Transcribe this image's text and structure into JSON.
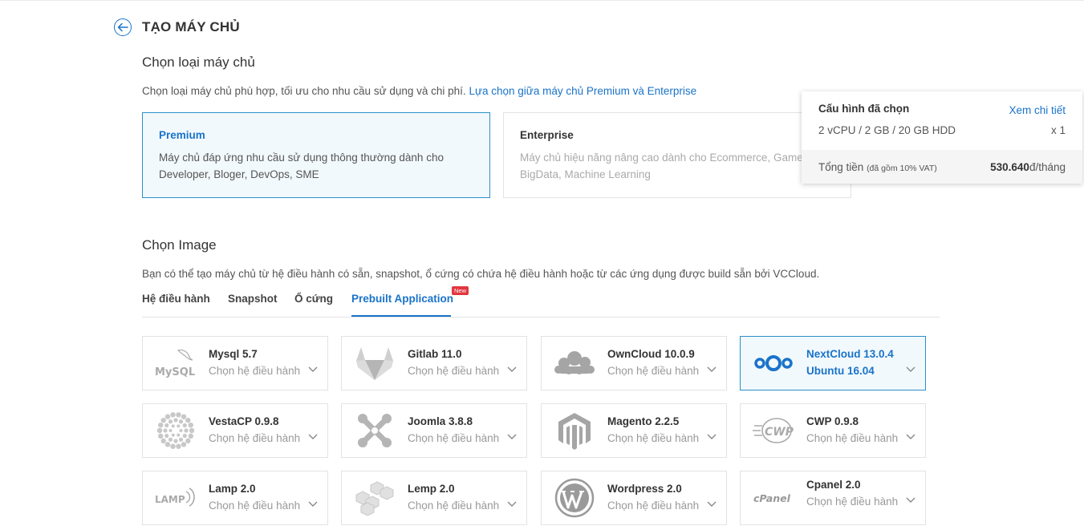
{
  "header": {
    "title": "TẠO MÁY CHỦ"
  },
  "server_type": {
    "heading": "Chọn loại máy chủ",
    "description": "Chọn loại máy chủ phù hợp, tối ưu cho nhu cầu sử dụng và chi phí.",
    "link": "Lựa chọn giữa máy chủ Premium và Enterprise",
    "options": [
      {
        "name": "Premium",
        "desc_line1": "Máy chủ đáp ứng nhu cầu sử dụng thông thường dành cho",
        "desc_line2": "Developer, Bloger, DevOps, SME",
        "selected": true
      },
      {
        "name": "Enterprise",
        "desc_line1": "Máy chủ hiệu năng nâng cao dành cho Ecommerce, Game,",
        "desc_line2": "BigData, Machine Learning",
        "selected": false
      }
    ]
  },
  "summary": {
    "heading": "Cấu hình đã chọn",
    "details_link": "Xem chi tiết",
    "config": "2 vCPU / 2 GB / 20 GB HDD",
    "quantity": "x 1",
    "total_label": "Tổng tiền",
    "vat_note": "(đã gồm 10% VAT)",
    "price": "530.640",
    "price_unit": "đ/tháng"
  },
  "image": {
    "heading": "Chọn Image",
    "description": "Bạn có thể tạo máy chủ từ hệ điều hành có sẵn, snapshot, ổ cứng có chứa hệ điều hành hoặc từ các ứng dụng được build sẵn bởi VCCloud.",
    "tabs": [
      {
        "label": "Hệ điều hành"
      },
      {
        "label": "Snapshot"
      },
      {
        "label": "Ổ cứng"
      },
      {
        "label": "Prebuilt Application",
        "active": true
      }
    ],
    "new_badge": "New"
  },
  "apps": [
    {
      "name": "Mysql 5.7",
      "os": "Chọn hệ điều hành",
      "icon": "mysql-logo-icon",
      "logo_text": "MySQL"
    },
    {
      "name": "Gitlab 11.0",
      "os": "Chọn hệ điều hành",
      "icon": "gitlab-logo-icon"
    },
    {
      "name": "OwnCloud 10.0.9",
      "os": "Chọn hệ điều hành",
      "icon": "owncloud-logo-icon"
    },
    {
      "name": "NextCloud 13.0.4",
      "os": "Ubuntu 16.04",
      "icon": "nextcloud-logo-icon",
      "selected": true
    },
    {
      "name": "VestaCP 0.9.8",
      "os": "Chọn hệ điều hành",
      "icon": "vestacp-logo-icon"
    },
    {
      "name": "Joomla 3.8.8",
      "os": "Chọn hệ điều hành",
      "icon": "joomla-logo-icon"
    },
    {
      "name": "Magento 2.2.5",
      "os": "Chọn hệ điều hành",
      "icon": "magento-logo-icon"
    },
    {
      "name": "CWP 0.9.8",
      "os": "Chọn hệ điều hành",
      "icon": "cwp-logo-icon",
      "logo_text": "CWP"
    },
    {
      "name": "Lamp 2.0",
      "os": "Chọn hệ điều hành",
      "icon": "lamp-logo-icon",
      "logo_text": "LAMP"
    },
    {
      "name": "Lemp 2.0",
      "os": "Chọn hệ điều hành",
      "icon": "lemp-logo-icon"
    },
    {
      "name": "Wordpress 2.0",
      "os": "Chọn hệ điều hành",
      "icon": "wordpress-logo-icon"
    },
    {
      "name": "Cpanel 2.0",
      "os": "Chọn hệ điều hành",
      "icon": "cpanel-logo-icon",
      "logo_text": "cPanel"
    }
  ],
  "colors": {
    "accent": "#1a73c9",
    "selected_bg": "#f2f9fd",
    "badge": "#e2363f"
  }
}
